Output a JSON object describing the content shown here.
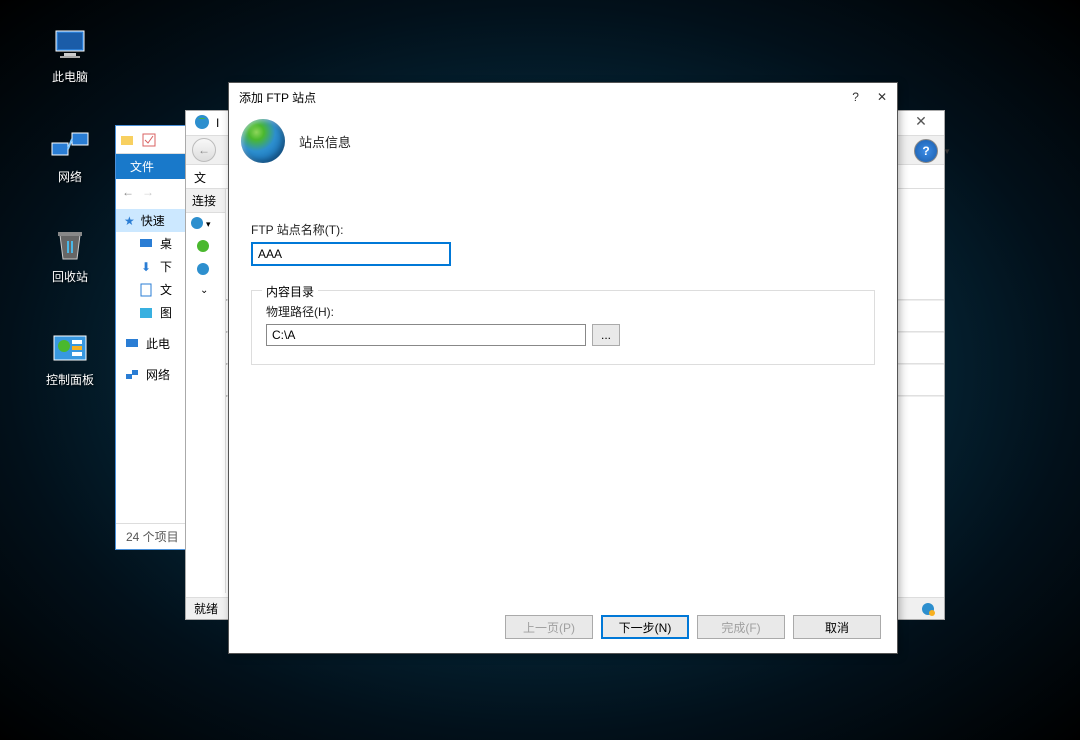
{
  "desktop": {
    "icons": [
      {
        "name": "this-pc",
        "label": "此电脑"
      },
      {
        "name": "network",
        "label": "网络"
      },
      {
        "name": "recycle-bin",
        "label": "回收站"
      },
      {
        "name": "control-panel",
        "label": "控制面板"
      }
    ]
  },
  "explorer": {
    "file_menu": "文件",
    "sidebar": {
      "quick_access": "快速",
      "desktop": "桌",
      "downloads": "下",
      "documents": "文",
      "pictures": "图",
      "this_pc": "此电",
      "network": "网络"
    },
    "status": "24 个项目"
  },
  "iis": {
    "title_prefix": "I",
    "menu_file": "文",
    "sidebar_header": "连接",
    "status_text": "就绪"
  },
  "ftp_dialog": {
    "title": "添加 FTP 站点",
    "header": "站点信息",
    "site_name_label": "FTP 站点名称(T):",
    "site_name_value": "AAA",
    "content_dir_legend": "内容目录",
    "physical_path_label": "物理路径(H):",
    "physical_path_value": "C:\\A",
    "browse_btn": "...",
    "btn_prev": "上一页(P)",
    "btn_next": "下一步(N)",
    "btn_finish": "完成(F)",
    "btn_cancel": "取消",
    "help": "?",
    "close": "✕"
  }
}
